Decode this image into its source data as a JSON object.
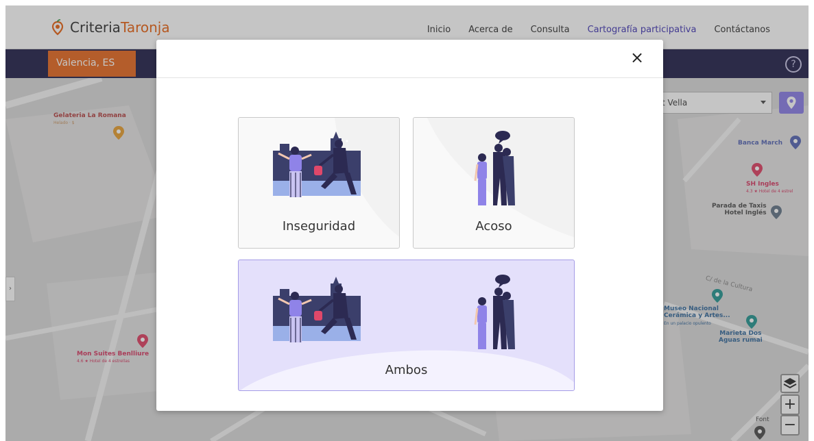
{
  "navbar": {
    "logo": {
      "part1": "Criteria",
      "part2": "Taronja"
    },
    "links": [
      "Inicio",
      "Acerca de",
      "Consulta",
      "Cartografía participativa",
      "Contáctanos"
    ],
    "active_index": 3
  },
  "subbar": {
    "city": "Valencia, ES",
    "help_glyph": "?"
  },
  "map": {
    "district_select": "t Vella",
    "labels": {
      "gelateria": "Gelateria La Romana",
      "gelateria_sub": "Helado · $",
      "banca": "Banca March",
      "sh_ingles": "SH Ingles",
      "sh_ingles_sub": "4.3 ★ Hotel de 4 estrel",
      "taxis": "Parada de Taxis\nHotel Inglés",
      "museo": "Museo Nacional\nCerámica y Artes...",
      "museo_sub": "En un palacio opulento",
      "marieta": "Marieta Dos\nAguas rumai",
      "mon_suites": "Mon Suites Benlliure",
      "mon_suites_sub": "4.6 ★ Hotel de 4 estrellas",
      "font": "Font",
      "street": "C/ de la Cultura"
    },
    "zoom_in": "+",
    "zoom_out": "−"
  },
  "modal": {
    "close_glyph": "×",
    "options": {
      "inseguridad": "Inseguridad",
      "acoso": "Acoso",
      "ambos": "Ambos"
    }
  },
  "colors": {
    "brand_orange": "#e8702a",
    "navy_bar": "#2c2a52",
    "accent_purple": "#8f83e8",
    "selected_card": "#e4e0fb"
  }
}
